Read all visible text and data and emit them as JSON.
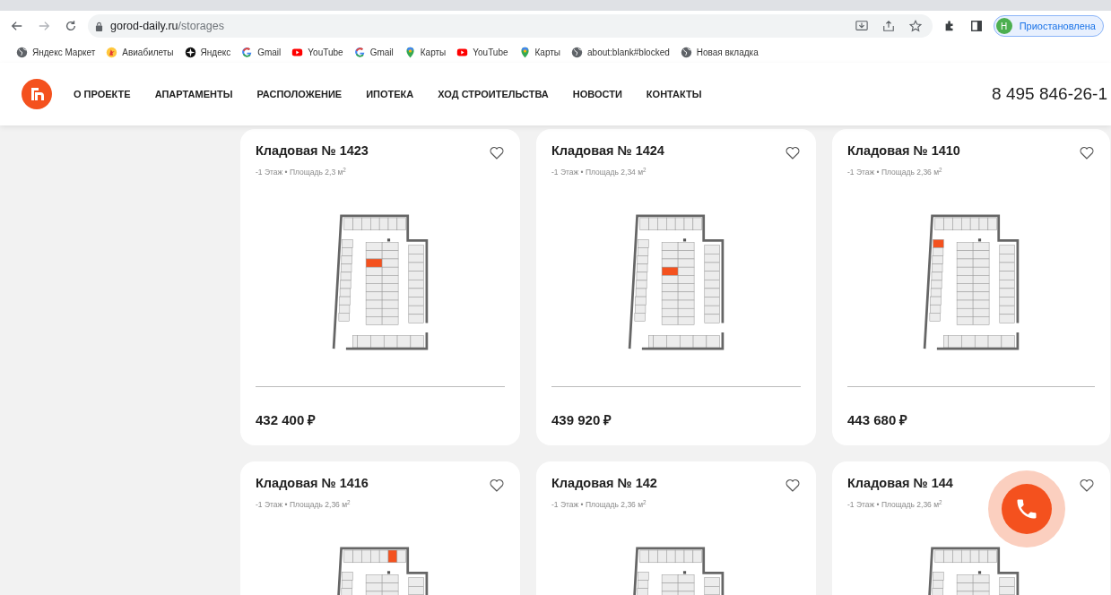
{
  "browser": {
    "url_host": "gorod-daily.ru",
    "url_path": "/storages",
    "profile_initial": "Н",
    "profile_status": "Приостановлена",
    "bookmarks": [
      {
        "label": "Яндекс Маркет",
        "kind": "globe"
      },
      {
        "label": "Авиабилеты",
        "kind": "plane"
      },
      {
        "label": "Яндекс",
        "kind": "compass"
      },
      {
        "label": "Gmail",
        "kind": "google"
      },
      {
        "label": "YouTube",
        "kind": "youtube"
      },
      {
        "label": "Gmail",
        "kind": "google"
      },
      {
        "label": "Карты",
        "kind": "maps"
      },
      {
        "label": "YouTube",
        "kind": "youtube"
      },
      {
        "label": "Карты",
        "kind": "maps"
      },
      {
        "label": "about:blank#blocked",
        "kind": "globe"
      },
      {
        "label": "Новая вкладка",
        "kind": "globe"
      }
    ]
  },
  "site": {
    "nav": [
      "О ПРОЕКТЕ",
      "АПАРТАМЕНТЫ",
      "РАСПОЛОЖЕНИЕ",
      "ИПОТЕКА",
      "ХОД СТРОИТЕЛЬСТВА",
      "НОВОСТИ",
      "КОНТАКТЫ"
    ],
    "phone": "8 495 846-26-1"
  },
  "storages": [
    {
      "title": "Кладовая № 1423",
      "details": "-1 Этаж • Площадь 2,3 м$^{2}$",
      "plan_cells": {
        "top": [
          false,
          false,
          false,
          false,
          false,
          false,
          false
        ],
        "left": [
          false,
          false,
          false,
          false,
          false,
          false,
          false,
          false,
          false,
          false
        ],
        "middle": [
          false,
          false,
          true,
          false,
          false,
          false,
          false,
          false,
          false,
          false
        ]
      },
      "price": "432 400 ₽"
    },
    {
      "title": "Кладовая № 1424",
      "details": "-1 Этаж • Площадь 2,34 м$^{2}$",
      "plan_cells": {
        "top": [
          false,
          false,
          false,
          false,
          false,
          false,
          false
        ],
        "left": [
          false,
          false,
          false,
          false,
          false,
          false,
          false,
          false,
          false,
          false
        ],
        "middle": [
          false,
          false,
          false,
          true,
          false,
          false,
          false,
          false,
          false,
          false
        ]
      },
      "price": "439 920 ₽"
    },
    {
      "title": "Кладовая № 1410",
      "details": "-1 Этаж • Площадь 2,36 м$^{2}$",
      "plan_cells": {
        "top": [
          false,
          false,
          false,
          false,
          false,
          false,
          false
        ],
        "left": [
          true,
          false,
          false,
          false,
          false,
          false,
          false,
          false,
          false,
          false
        ],
        "middle": [
          false,
          false,
          false,
          false,
          false,
          false,
          false,
          false,
          false,
          false
        ]
      },
      "price": "443 680 ₽"
    },
    {
      "title": "Кладовая № 1416",
      "details": "-1 Этаж • Площадь 2,36 м$^{2}$",
      "plan_cells": {
        "top": [
          false,
          false,
          false,
          false,
          false,
          true,
          false
        ]
      }
    },
    {
      "title": "Кладовая № 142",
      "details": "-1 Этаж • Площадь 2,36 м$^{2}$",
      "plan_cells": {
        "top": [
          false,
          false,
          false,
          false,
          false,
          false,
          false
        ]
      }
    },
    {
      "title": "Кладовая № 144",
      "details": "-1 Этаж • Площадь 2,36 м$^{2}$",
      "plan_cells": {
        "top": [
          false,
          false,
          false,
          false,
          false,
          false,
          false
        ]
      }
    }
  ]
}
